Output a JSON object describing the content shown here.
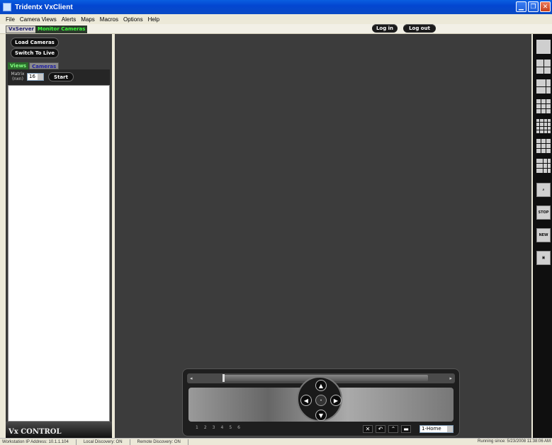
{
  "window": {
    "title": "Tridentx VxClient"
  },
  "menu": [
    "File",
    "Camera Views",
    "Alerts",
    "Maps",
    "Macros",
    "Options",
    "Help"
  ],
  "tabs": {
    "vxserver": "VxServer",
    "monitor_cameras": "Monitor Cameras"
  },
  "header": {
    "login": "Log in",
    "logout": "Log out"
  },
  "left": {
    "load_cameras": "Load Cameras",
    "switch_to_live": "Switch To Live",
    "subtabs": {
      "views": "Views",
      "cameras": "Cameras"
    },
    "matrix_label": "Matrix (nxn)",
    "matrix_value": "16",
    "start": "Start",
    "footer": "Vx CONTROL"
  },
  "right_panel": {
    "actions": {
      "stop": "STOP",
      "new": "NEW"
    }
  },
  "ptz": {
    "preset_selected": "1-Home",
    "presets": [
      "1",
      "2",
      "3",
      "4",
      "5",
      "6"
    ]
  },
  "status": {
    "ip": "Workstation IP Address: 10.1.1.104",
    "local": "Local Discovery: ON",
    "remote": "Remote Discovery: ON",
    "running": "Running since: 5/23/2008 11:38:06 AM"
  },
  "colors": {
    "titlebar": "#0346d1",
    "monitor_tab_text": "#39ff39",
    "background": "#3c3c3c"
  }
}
